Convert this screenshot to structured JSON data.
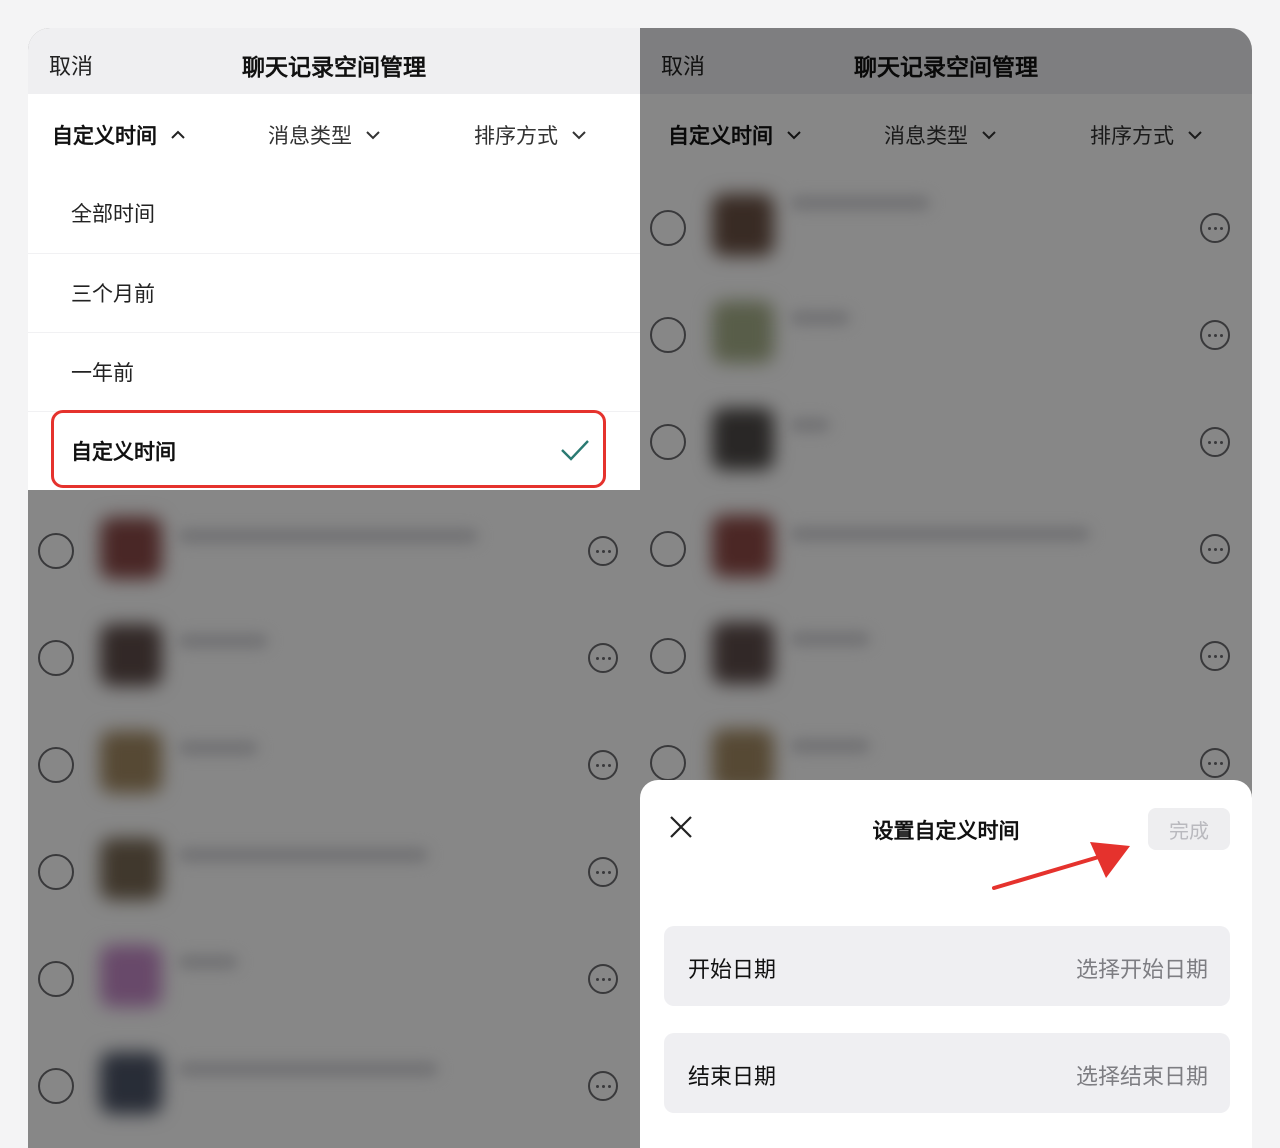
{
  "left_screen": {
    "nav": {
      "cancel": "取消",
      "title": "聊天记录空间管理"
    },
    "filters": [
      {
        "label": "自定义时间",
        "state": "expanded"
      },
      {
        "label": "消息类型",
        "state": "collapsed"
      },
      {
        "label": "排序方式",
        "state": "collapsed"
      }
    ],
    "time_options": [
      {
        "label": "全部时间",
        "selected": false
      },
      {
        "label": "三个月前",
        "selected": false
      },
      {
        "label": "一年前",
        "selected": false
      },
      {
        "label": "自定义时间",
        "selected": true
      }
    ],
    "highlight_color": "#e5322d",
    "check_color": "#2a7a72"
  },
  "right_screen": {
    "nav": {
      "cancel": "取消",
      "title": "聊天记录空间管理"
    },
    "filters": [
      {
        "label": "自定义时间",
        "state": "collapsed"
      },
      {
        "label": "消息类型",
        "state": "collapsed"
      },
      {
        "label": "排序方式",
        "state": "collapsed"
      }
    ],
    "sheet": {
      "title": "设置自定义时间",
      "done": "完成",
      "done_enabled": false,
      "start": {
        "label": "开始日期",
        "placeholder": "选择开始日期"
      },
      "end": {
        "label": "结束日期",
        "placeholder": "选择结束日期"
      }
    },
    "arrow_color": "#e5322d"
  },
  "icons": [
    "chevron-up-icon",
    "chevron-down-icon",
    "checkmark-icon",
    "close-icon",
    "more-icon",
    "arrow-icon"
  ],
  "colors": {
    "overlay": "rgba(0,0,0,0.47)",
    "nav_bg": "#efeff1",
    "field_bg": "#efeff2"
  }
}
